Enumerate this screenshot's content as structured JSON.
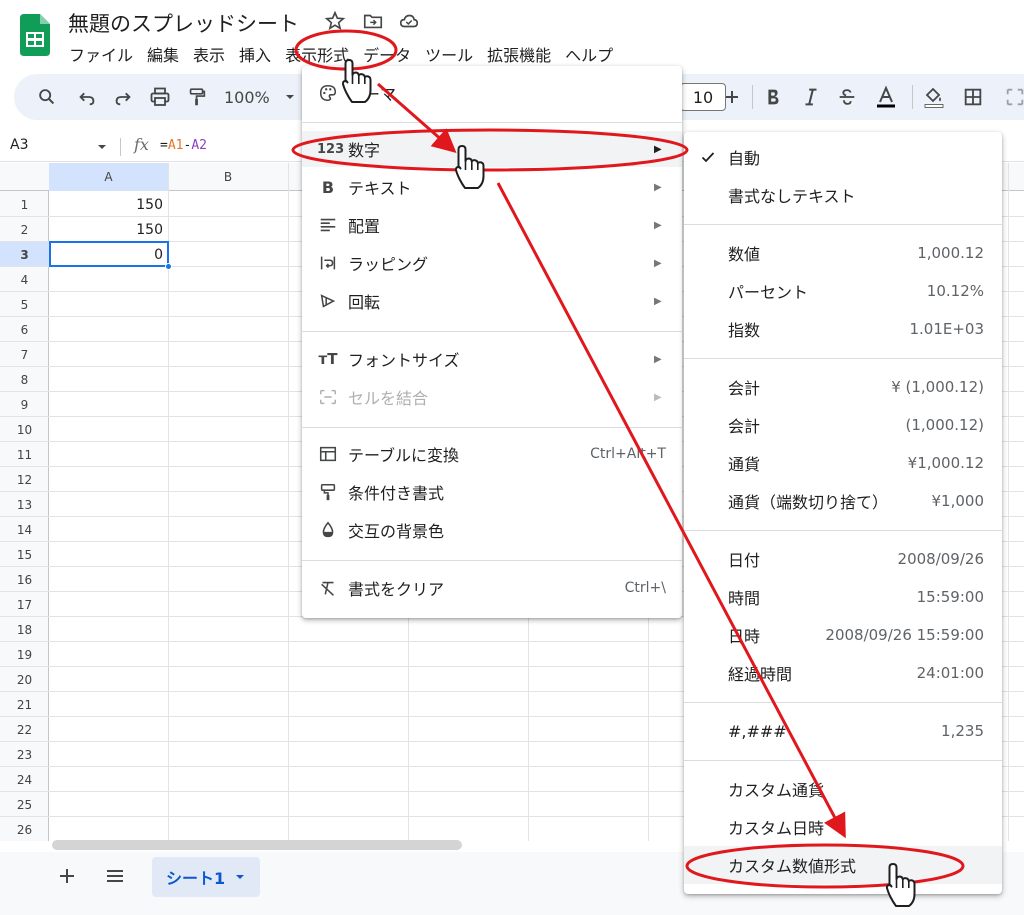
{
  "doc": {
    "title": "無題のスプレッドシート"
  },
  "menubar": [
    "ファイル",
    "編集",
    "表示",
    "挿入",
    "表示形式",
    "データ",
    "ツール",
    "拡張機能",
    "ヘルプ"
  ],
  "toolbar": {
    "zoom": "100%",
    "font_size": "10"
  },
  "formula_bar": {
    "cell_ref": "A3",
    "fx": "fx",
    "eq": "=",
    "ref1": "A1",
    "op": "-",
    "ref2": "A2"
  },
  "grid": {
    "columns": [
      "A",
      "B"
    ],
    "rows": [
      "1",
      "2",
      "3",
      "4",
      "5",
      "6",
      "7",
      "8",
      "9",
      "10",
      "11",
      "12",
      "13",
      "14",
      "15",
      "16",
      "17",
      "18",
      "19",
      "20",
      "21",
      "22",
      "23",
      "24",
      "25",
      "26"
    ],
    "cells": {
      "A1": "150",
      "A2": "150",
      "A3": "0"
    }
  },
  "sheets": {
    "active": "シート1"
  },
  "format_menu": {
    "theme_label": "テーマ",
    "items": [
      {
        "label": "数字"
      },
      {
        "label": "テキスト"
      },
      {
        "label": "配置"
      },
      {
        "label": "ラッピング"
      },
      {
        "label": "回転"
      },
      {
        "label": "フォントサイズ"
      },
      {
        "label": "セルを結合"
      },
      {
        "label": "テーブルに変換",
        "shortcut": "Ctrl+Alt+T"
      },
      {
        "label": "条件付き書式"
      },
      {
        "label": "交互の背景色"
      },
      {
        "label": "書式をクリア",
        "shortcut": "Ctrl+\\"
      }
    ]
  },
  "number_menu": {
    "items": [
      {
        "label": "自動"
      },
      {
        "label": "書式なしテキスト"
      },
      {
        "label": "数値",
        "example": "1,000.12"
      },
      {
        "label": "パーセント",
        "example": "10.12%"
      },
      {
        "label": "指数",
        "example": "1.01E+03"
      },
      {
        "label": "会計",
        "example": "¥ (1,000.12)"
      },
      {
        "label": "会計",
        "example": "(1,000.12)"
      },
      {
        "label": "通貨",
        "example": "¥1,000.12"
      },
      {
        "label": "通貨（端数切り捨て）",
        "example": "¥1,000"
      },
      {
        "label": "日付",
        "example": "2008/09/26"
      },
      {
        "label": "時間",
        "example": "15:59:00"
      },
      {
        "label": "日時",
        "example": "2008/09/26 15:59:00"
      },
      {
        "label": "経過時間",
        "example": "24:01:00"
      },
      {
        "label": "#,###",
        "example": "1,235"
      },
      {
        "label": "カスタム通貨"
      },
      {
        "label": "カスタム日時"
      },
      {
        "label": "カスタム数値形式"
      }
    ]
  },
  "colors": {
    "accent": "#1a73e8",
    "annotation": "#e0181d",
    "sheets_green": "#0f9d58"
  },
  "icons": {
    "checkmark": "check-icon"
  }
}
